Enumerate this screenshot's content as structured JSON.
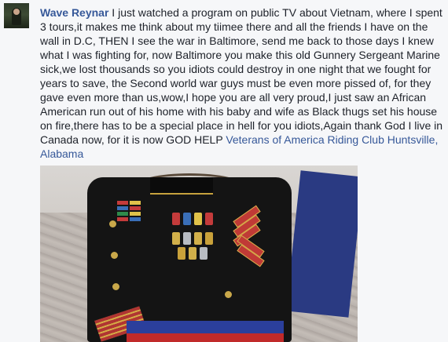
{
  "comment": {
    "author_name": "Wave Reynar",
    "text": " I just watched a program on public TV about Vietnam, where I spent 3 tours,it makes me think about my tiimee there and all the friends I have on the wall in D.C, THEN I see the war in Baltimore, send me back to those days I knew what I was fighting for, now Baltimore you make this old Gunnery Sergeant Marine sick,we lost thousands so you idiots could destroy in one night that we fought for years to save, the Second world war guys must be even more pissed of, for they gave even more than us,wow,I hope you are all very proud,I just saw an African American run out of his home with his baby and wife as Black thugs set his house on fire,there has to be a special place in hell for you idiots,Again thank God I live in Canada now, for it is now GOD HELP ",
    "tagged_page": "Veterans of America Riding Club Huntsville, Alabama"
  },
  "colors": {
    "link": "#365899",
    "text": "#1d2129",
    "background": "#f6f7f9"
  },
  "icons": {
    "avatar": "profile-photo",
    "photo": "marine-dress-blues-jacket-photo"
  }
}
